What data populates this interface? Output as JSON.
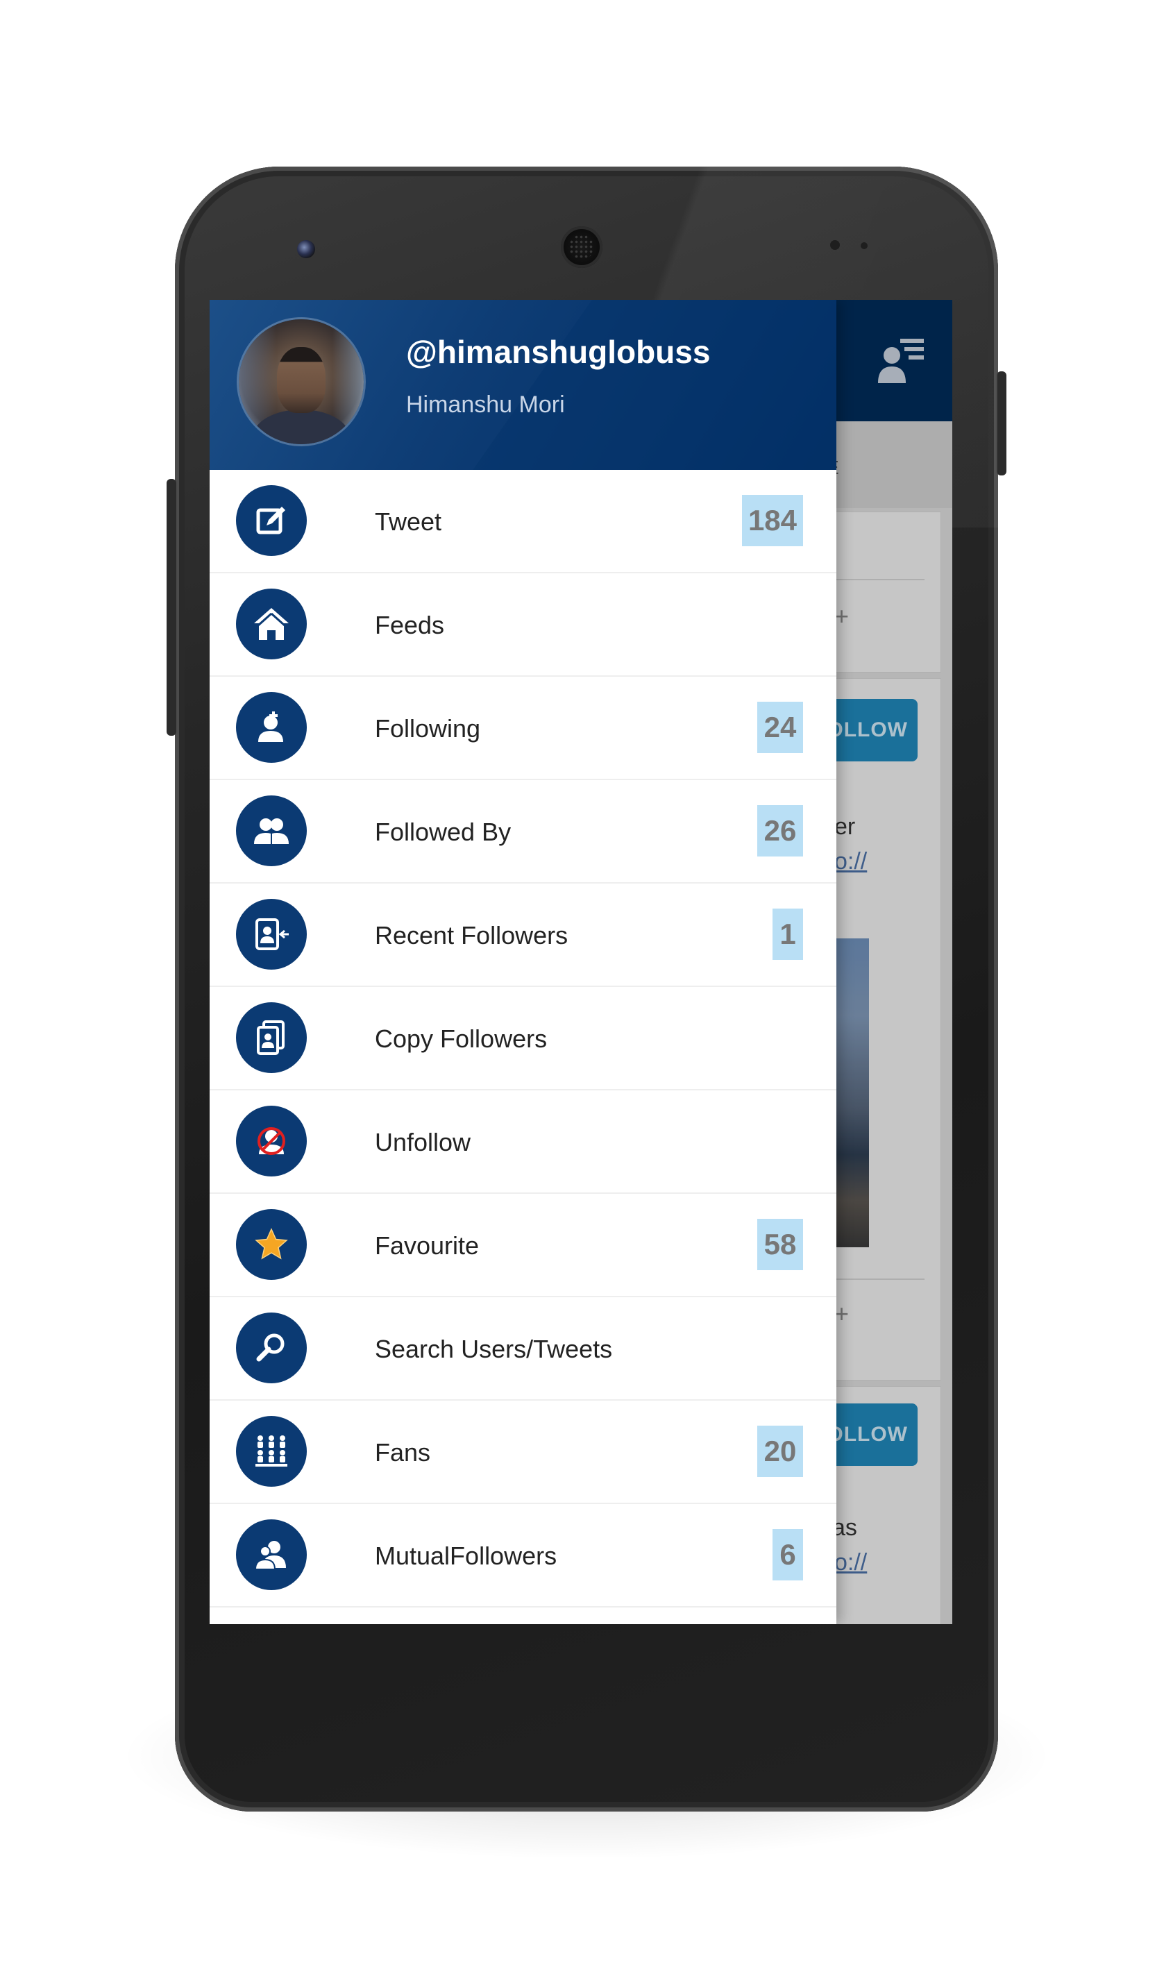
{
  "drawer": {
    "username": "@himanshuglobuss",
    "fullname": "Himanshu Mori"
  },
  "menu": [
    {
      "label": "Tweet",
      "badge": "184",
      "icon": "compose-icon"
    },
    {
      "label": "Feeds",
      "badge": null,
      "icon": "home-icon"
    },
    {
      "label": "Following",
      "badge": "24",
      "icon": "user-follow-icon"
    },
    {
      "label": "Followed By",
      "badge": "26",
      "icon": "users-group-icon"
    },
    {
      "label": "Recent Followers",
      "badge": "1",
      "icon": "contact-card-icon"
    },
    {
      "label": "Copy Followers",
      "badge": null,
      "icon": "copy-contact-icon"
    },
    {
      "label": "Unfollow",
      "badge": null,
      "icon": "unfollow-icon"
    },
    {
      "label": "Favourite",
      "badge": "58",
      "icon": "star-icon"
    },
    {
      "label": "Search Users/Tweets",
      "badge": null,
      "icon": "search-icon"
    },
    {
      "label": "Fans",
      "badge": "20",
      "icon": "crowd-icon"
    },
    {
      "label": "MutualFollowers",
      "badge": "6",
      "icon": "mutual-users-icon"
    }
  ],
  "background_app": {
    "tab_fragment": "E",
    "follow_button_1": "OLLOW",
    "follow_button_2": "OLLOW",
    "text_fragment_1": "er",
    "link_fragment_1": "o://",
    "text_fragment_2": "vas",
    "link_fragment_2": "o://",
    "plus_1": "+",
    "plus_2": "+"
  },
  "colors": {
    "header_bg": "#0e3d75",
    "icon_bg": "#0b3a73",
    "badge_bg": "#b9dff5",
    "badge_text": "#777777",
    "star": "#f5a623"
  }
}
